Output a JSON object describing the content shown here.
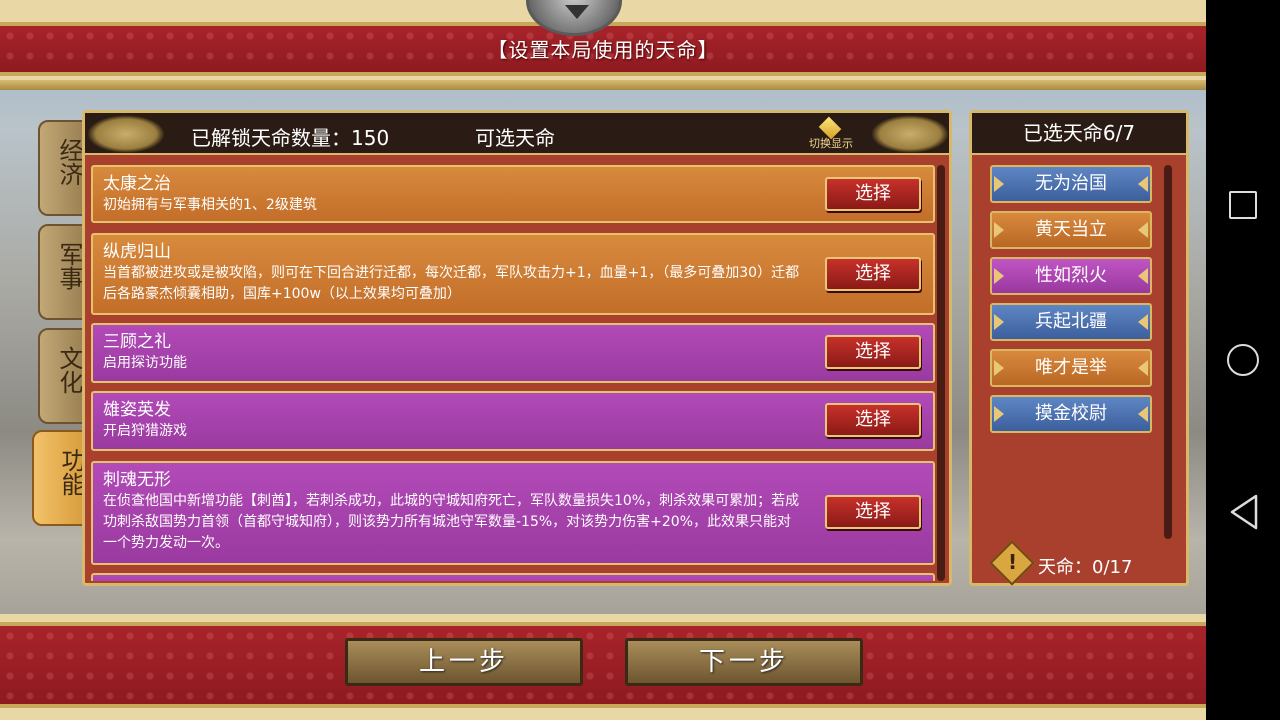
{
  "header": {
    "title": "【设置本局使用的天命】"
  },
  "side_tabs": [
    {
      "label": "经济",
      "active": false
    },
    {
      "label": "军事",
      "active": false
    },
    {
      "label": "文化",
      "active": false
    },
    {
      "label": "功能",
      "active": true
    }
  ],
  "main": {
    "unlocked_label": "已解锁天命数量：150",
    "selectable_label": "可选天命",
    "toggle_display_label": "切换显示",
    "select_button_label": "选择",
    "items": [
      {
        "title": "太康之治",
        "desc": "初始拥有与军事相关的1、2级建筑",
        "color": "orange"
      },
      {
        "title": "纵虎归山",
        "desc": "当首都被进攻或是被攻陷，则可在下回合进行迁都，每次迁都，军队攻击力+1，血量+1，（最多可叠加30）迁都后各路豪杰倾囊相助，国库+100w（以上效果均可叠加）",
        "color": "orange"
      },
      {
        "title": "三顾之礼",
        "desc": "启用探访功能",
        "color": "purple"
      },
      {
        "title": "雄姿英发",
        "desc": "开启狩猎游戏",
        "color": "purple"
      },
      {
        "title": "刺魂无形",
        "desc": "在侦查他国中新增功能【刺酋】，若刺杀成功，此城的守城知府死亡，军队数量损失10%，刺杀效果可累加；若成功刺杀敌国势力首领（首都守城知府），则该势力所有城池守军数量-15%，对该势力伤害+20%，此效果只能对一个势力发动一次。",
        "color": "purple"
      }
    ]
  },
  "selected": {
    "header": "已选天命6/7",
    "items": [
      {
        "label": "无为治国",
        "color": "blue"
      },
      {
        "label": "黄天当立",
        "color": "orange"
      },
      {
        "label": "性如烈火",
        "color": "purple"
      },
      {
        "label": "兵起北疆",
        "color": "blue"
      },
      {
        "label": "唯才是举",
        "color": "orange"
      },
      {
        "label": "摸金校尉",
        "color": "blue"
      }
    ],
    "destiny_count": "天命：0/17"
  },
  "footer": {
    "prev_label": "上一步",
    "next_label": "下一步"
  }
}
